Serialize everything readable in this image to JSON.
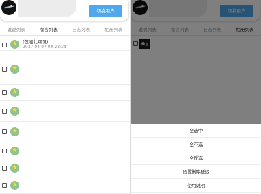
{
  "left_panel": {
    "header": {
      "switch_button": "切换用户"
    },
    "tabs": [
      {
        "label": "说说列表",
        "active": false
      },
      {
        "label": "留言列表",
        "active": true
      },
      {
        "label": "日志列表",
        "active": false
      },
      {
        "label": "相册列表",
        "active": false
      }
    ],
    "rows": [
      {
        "title": "(仅彼此可见)",
        "time": "2017-04-07 00:23:38"
      },
      {
        "title": "",
        "time": ""
      },
      {
        "title": "",
        "time": ""
      },
      {
        "title": "",
        "time": ""
      },
      {
        "title": "",
        "time": ""
      },
      {
        "title": "",
        "time": ""
      },
      {
        "title": "",
        "time": ""
      },
      {
        "title": "",
        "time": ""
      }
    ]
  },
  "right_panel": {
    "header": {
      "switch_button": "切换用户"
    },
    "tabs": [
      {
        "label": "说说列表",
        "active": false
      },
      {
        "label": "留言列表",
        "active": false
      },
      {
        "label": "日志列表",
        "active": false
      },
      {
        "label": "相册列表",
        "active": true
      }
    ],
    "action_sheet": [
      "全选中",
      "全不选",
      "全反选",
      "设置删除延迟",
      "使用说明"
    ]
  },
  "colors": {
    "accent": "#4fa7ee",
    "overlay": "rgba(0,0,0,0.5)",
    "avatar_face": "#8fc48c"
  }
}
